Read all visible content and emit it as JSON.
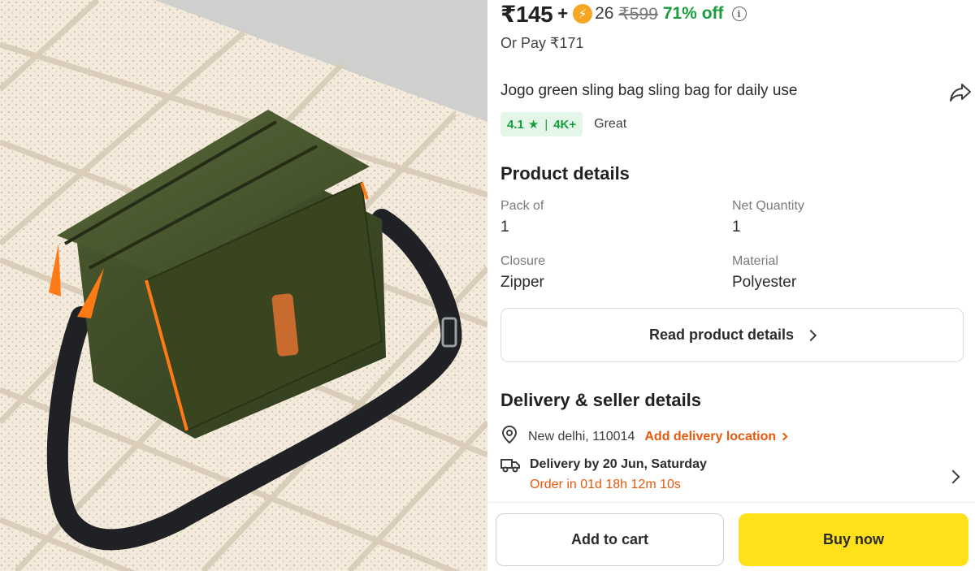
{
  "colors": {
    "discount_green": "#1a9c3c",
    "accent_orange": "#e8590c",
    "buy_yellow": "#ffe11b",
    "bag_olive": "#3e4a27"
  },
  "product_image": {
    "description_icon": "product-photo"
  },
  "pricing": {
    "price": "₹145",
    "plus": "+",
    "coin_icon": "lightning-coin-icon",
    "coins": "26",
    "mrp": "₹599",
    "discount": "71% off",
    "or_pay": "Or Pay ₹171"
  },
  "product": {
    "title": "Jogo green sling bag sling bag for daily use",
    "rating": "4.1",
    "rating_count": "4K+",
    "rating_label": "Great"
  },
  "product_details": {
    "heading": "Product details",
    "items": [
      {
        "label": "Pack of",
        "value": "1"
      },
      {
        "label": "Net Quantity",
        "value": "1"
      },
      {
        "label": "Closure",
        "value": "Zipper"
      },
      {
        "label": "Material",
        "value": "Polyester"
      }
    ],
    "read_more": "Read product details"
  },
  "delivery": {
    "heading": "Delivery & seller details",
    "location": "New delhi, 110014",
    "add_location": "Add delivery location",
    "delivery_date": "Delivery by 20 Jun, Saturday",
    "countdown": "Order in 01d 18h 12m 10s"
  },
  "actions": {
    "add_to_cart": "Add to cart",
    "buy_now": "Buy now"
  }
}
